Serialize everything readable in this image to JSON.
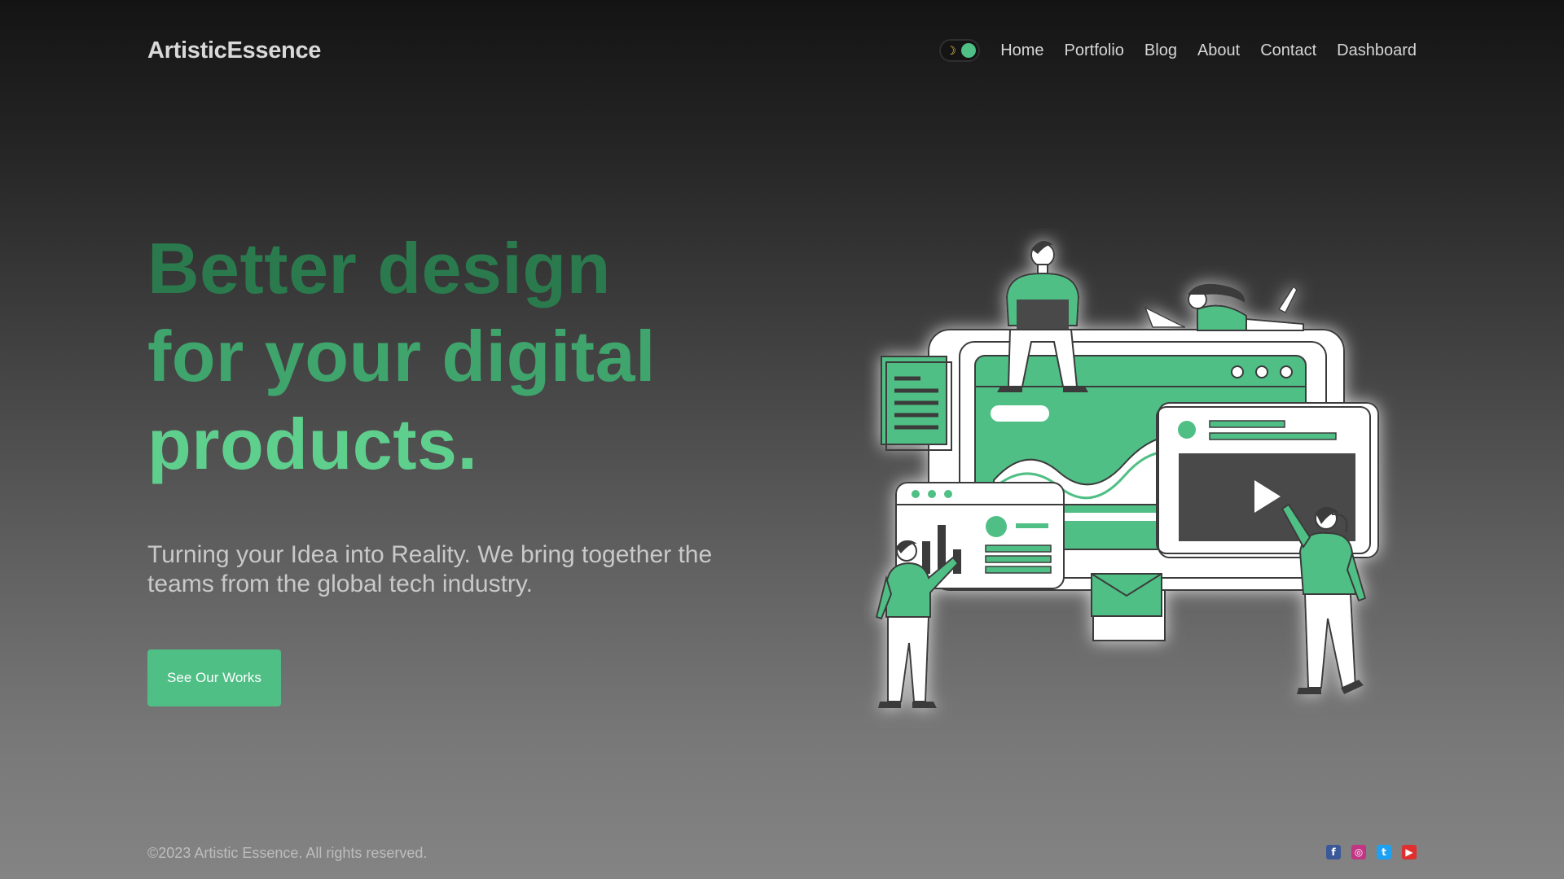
{
  "brand": {
    "name": "ArtisticEssence"
  },
  "nav": {
    "theme_toggle": {
      "icon": "moon-icon",
      "mode": "dark"
    },
    "items": [
      {
        "label": "Home"
      },
      {
        "label": "Portfolio"
      },
      {
        "label": "Blog"
      },
      {
        "label": "About"
      },
      {
        "label": "Contact"
      },
      {
        "label": "Dashboard"
      }
    ]
  },
  "hero": {
    "headline": {
      "line1": "Better design",
      "line2": "for your digital",
      "line3": "products."
    },
    "subtitle": "Turning your Idea into Reality. We bring together the teams from the global tech industry.",
    "cta_label": "See Our Works",
    "illustration": "team-collaboration-illustration"
  },
  "footer": {
    "copyright": "©2023 Artistic Essence. All rights reserved.",
    "socials": [
      {
        "icon": "facebook-icon",
        "glyph": "f"
      },
      {
        "icon": "instagram-icon",
        "glyph": "◎"
      },
      {
        "icon": "twitter-icon",
        "glyph": "t"
      },
      {
        "icon": "youtube-icon",
        "glyph": "▶"
      }
    ]
  },
  "colors": {
    "accent": "#4fbf85",
    "headline_dark": "#2a7a4e",
    "headline_mid": "#3fa56d",
    "headline_light": "#5ecf8d",
    "text": "#d6d6d6",
    "facebook": "#3b5998",
    "instagram": "#c13584",
    "twitter": "#1da1f2",
    "youtube": "#e02f2f"
  }
}
